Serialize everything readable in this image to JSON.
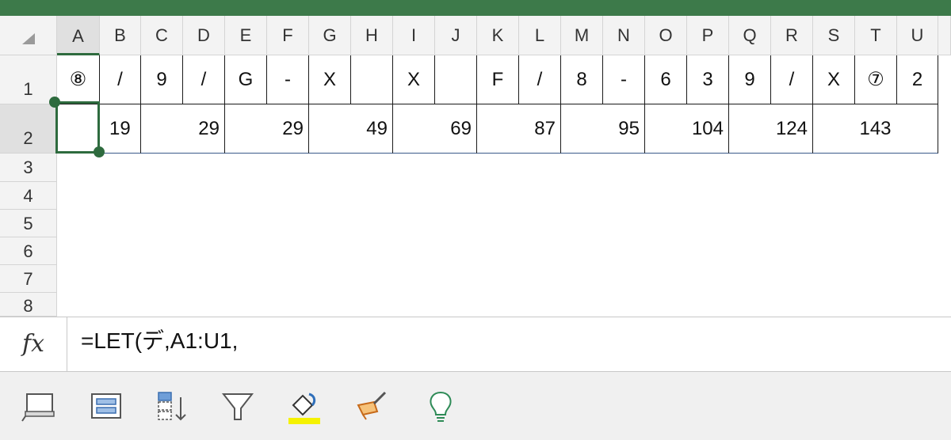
{
  "sheet": {
    "columns": [
      "A",
      "B",
      "C",
      "D",
      "E",
      "F",
      "G",
      "H",
      "I",
      "J",
      "K",
      "L",
      "M",
      "N",
      "O",
      "P",
      "Q",
      "R",
      "S",
      "T",
      "U"
    ],
    "rows": [
      "1",
      "2",
      "3",
      "4",
      "5",
      "6",
      "7",
      "8"
    ],
    "row1_values": [
      "⑧",
      "/",
      "9",
      "/",
      "G",
      "-",
      "X",
      "",
      "X",
      "",
      "F",
      "/",
      "8",
      "-",
      "6",
      "3",
      "9",
      "/",
      "X",
      "⑦",
      "2"
    ],
    "row2_cells": [
      {
        "col": "A",
        "value": ""
      },
      {
        "col": "B",
        "value": "19"
      },
      {
        "col": "C-D",
        "value": "29"
      },
      {
        "col": "E-F",
        "value": "29"
      },
      {
        "col": "G-H",
        "value": "49"
      },
      {
        "col": "I-J",
        "value": "69"
      },
      {
        "col": "K-L",
        "value": "87"
      },
      {
        "col": "M-N",
        "value": "95"
      },
      {
        "col": "O-P",
        "value": "104"
      },
      {
        "col": "Q-R",
        "value": "124"
      },
      {
        "col": "S-U",
        "value": "143"
      }
    ],
    "selected_cell": "A2"
  },
  "formula_bar": {
    "fx_label": "fx",
    "formula": "=LET(デ,A1:U1,"
  },
  "toolbar": {
    "icons": [
      "window-icon",
      "freeze-panes-icon",
      "sort-icon",
      "filter-icon",
      "fill-color-icon",
      "format-painter-icon",
      "ideas-bulb-icon"
    ]
  },
  "colors": {
    "accent_green": "#2e6b3e",
    "topbar_green": "#3d7a4a",
    "highlight_yellow": "#f5f200"
  }
}
